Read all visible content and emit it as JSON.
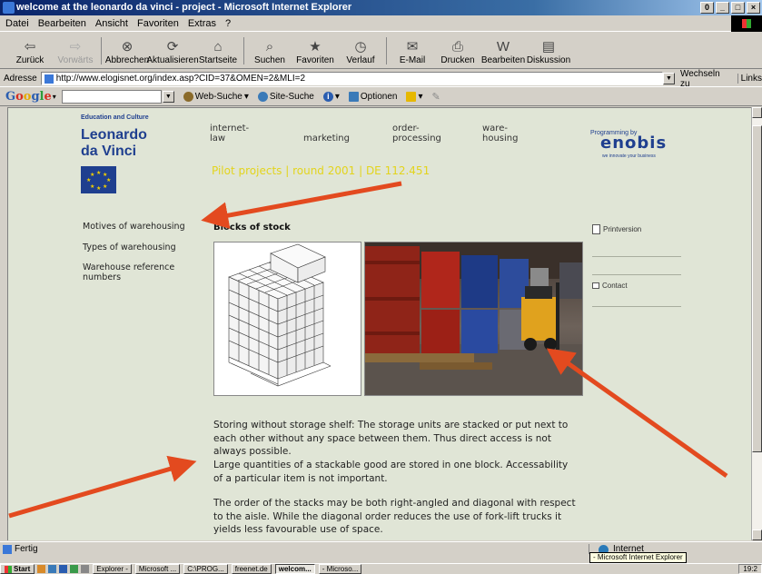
{
  "window": {
    "title": "welcome at the leonardo da vinci - project - Microsoft Internet Explorer",
    "buttons": [
      "0",
      "_",
      "□",
      "×"
    ]
  },
  "menubar": [
    "Datei",
    "Bearbeiten",
    "Ansicht",
    "Favoriten",
    "Extras",
    "?"
  ],
  "toolbar": {
    "buttons": [
      {
        "label": "Zurück",
        "icon": "⇦",
        "disabled": false
      },
      {
        "label": "Vorwärts",
        "icon": "⇨",
        "disabled": true
      },
      {
        "label": "Abbrechen",
        "icon": "⊗",
        "disabled": false
      },
      {
        "label": "Aktualisieren",
        "icon": "⟳",
        "disabled": false
      },
      {
        "label": "Startseite",
        "icon": "⌂",
        "disabled": false
      },
      {
        "label": "Suchen",
        "icon": "⌕",
        "disabled": false
      },
      {
        "label": "Favoriten",
        "icon": "★",
        "disabled": false
      },
      {
        "label": "Verlauf",
        "icon": "◷",
        "disabled": false
      },
      {
        "label": "E-Mail",
        "icon": "✉",
        "disabled": false
      },
      {
        "label": "Drucken",
        "icon": "⎙",
        "disabled": false
      },
      {
        "label": "Bearbeiten",
        "icon": "W",
        "disabled": false
      },
      {
        "label": "Diskussion",
        "icon": "▤",
        "disabled": false
      }
    ]
  },
  "address": {
    "label": "Adresse",
    "url": "http://www.elogisnet.org/index.asp?CID=37&OMEN=2&MLI=2",
    "go": "Wechseln zu",
    "links": "Links"
  },
  "googlebar": {
    "logo": "Google",
    "web_search": "Web-Suche",
    "site_search": "Site-Suche",
    "info": "i",
    "options": "Optionen"
  },
  "page": {
    "edu": "Education and Culture",
    "brand_line1": "Leonardo",
    "brand_line2": "da Vinci",
    "nav": [
      {
        "l1": "internet-",
        "l2": "law"
      },
      {
        "l1": "",
        "l2": "marketing"
      },
      {
        "l1": "order-",
        "l2": "processing"
      },
      {
        "l1": "ware-",
        "l2": "housing"
      }
    ],
    "pilot": "Pilot projects | round 2001 | DE 112.451",
    "programming_by": "Programming by",
    "enobis": "enobis",
    "tagline": "we innovate your business",
    "side_links": [
      "Motives of warehousing",
      "Types of warehousing",
      "Warehouse reference numbers"
    ],
    "heading": "Blocks of stock",
    "para1": "Storing without storage shelf: The storage units are stacked or put next to each other without any space between them. Thus direct access is not always possible.",
    "para2": "Large quantities of a stackable good are stored in one block. Accessability of a particular item is not important.",
    "para3": "The order of the stacks may be both right-angled and diagonal with respect to the aisle. While the diagonal order reduces the use of fork-lift trucks it yields less favourable use of space.",
    "printversion": "Printversion",
    "contact": "Contact"
  },
  "statusbar": {
    "status": "Fertig",
    "zone": "Internet",
    "tooltip": "- Microsoft Internet Explorer"
  },
  "taskbar": {
    "start": "Start",
    "tasks": [
      {
        "label": "Explorer -",
        "active": false
      },
      {
        "label": "Microsoft ...",
        "active": false
      },
      {
        "label": "C:\\PROG...",
        "active": false
      },
      {
        "label": "freenet.de",
        "active": false
      },
      {
        "label": "welcom...",
        "active": true
      },
      {
        "label": "- Microso...",
        "active": false
      }
    ],
    "clock": "19:2"
  },
  "colors": {
    "page_bg": "#e0e5d6",
    "brand_blue": "#1f3f8f",
    "pilot_yellow": "#e3d41c",
    "arrow_red": "#e34a1f",
    "title_blue": "#0a246a"
  }
}
